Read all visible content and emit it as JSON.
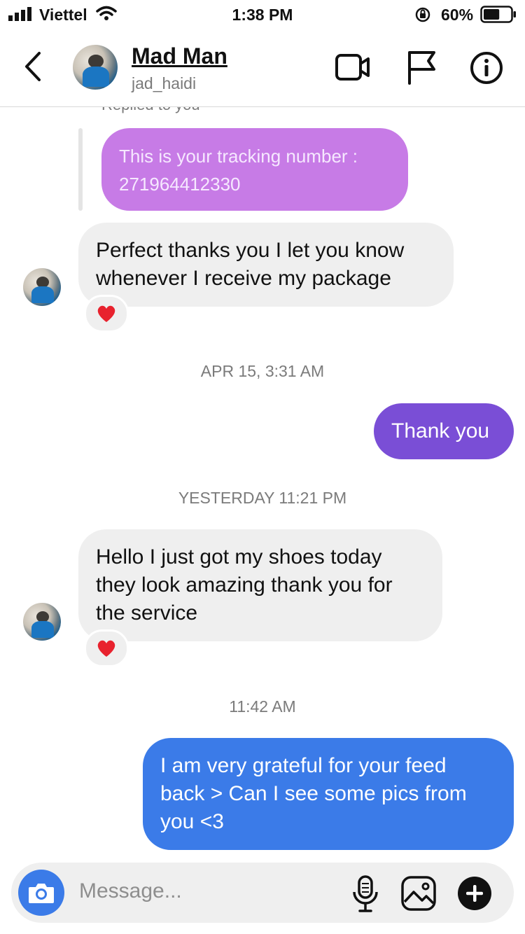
{
  "status_bar": {
    "carrier": "Viettel",
    "time": "1:38 PM",
    "battery_percent": "60%",
    "battery_level": 0.6
  },
  "header": {
    "name": "Mad Man",
    "handle": "jad_haidi"
  },
  "thread": {
    "replied_label": "Replied to you",
    "reply_quote": "This is your tracking number : 271964412330",
    "msg1": "Perfect thanks you I let you know whenever I receive my package",
    "ts1": "APR 15, 3:31 AM",
    "msg2": "Thank you",
    "ts2": "YESTERDAY 11:21 PM",
    "msg3": "Hello I just got my shoes today they look amazing thank you for the service",
    "ts3": "11:42 AM",
    "msg4": "I am very grateful for your feed back > Can I see some pics from you <3"
  },
  "composer": {
    "placeholder": "Message..."
  },
  "colors": {
    "incoming": "#efefef",
    "outgoing_purple": "#7a4ed6",
    "outgoing_blue": "#3b7be8",
    "reply_quote": "#c77be6",
    "heart": "#e8222e"
  }
}
